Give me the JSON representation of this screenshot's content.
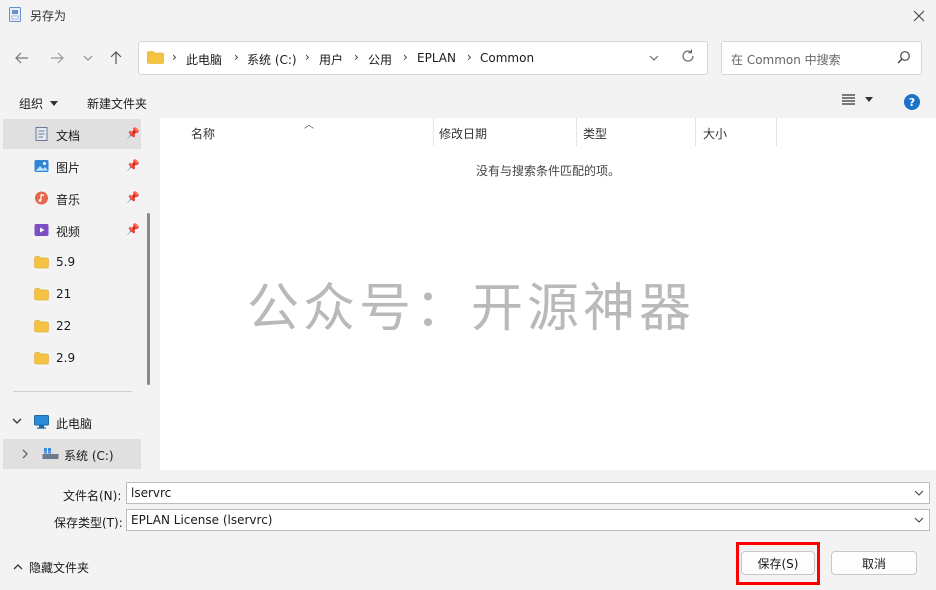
{
  "window": {
    "title": "另存为"
  },
  "address": {
    "crumbs": [
      "此电脑",
      "系统 (C:)",
      "用户",
      "公用",
      "EPLAN",
      "Common"
    ]
  },
  "search": {
    "placeholder": "在 Common 中搜索"
  },
  "toolbar": {
    "organize": "组织",
    "new_folder": "新建文件夹"
  },
  "sidebar": {
    "items": [
      {
        "label": "文档",
        "icon": "document-icon",
        "pinned": true
      },
      {
        "label": "图片",
        "icon": "picture-icon",
        "pinned": true
      },
      {
        "label": "音乐",
        "icon": "music-icon",
        "pinned": true
      },
      {
        "label": "视频",
        "icon": "video-icon",
        "pinned": true
      },
      {
        "label": "5.9",
        "icon": "folder-icon",
        "pinned": false
      },
      {
        "label": "21",
        "icon": "folder-icon",
        "pinned": false
      },
      {
        "label": "22",
        "icon": "folder-icon",
        "pinned": false
      },
      {
        "label": "2.9",
        "icon": "folder-icon",
        "pinned": false
      }
    ],
    "this_pc": "此电脑",
    "drive_c": "系统 (C:)"
  },
  "columns": [
    "名称",
    "修改日期",
    "类型",
    "大小"
  ],
  "empty_message": "没有与搜索条件匹配的项。",
  "watermark": "公众号：开源神器",
  "form": {
    "filename_label": "文件名(N):",
    "filename_value": "lservrc",
    "filetype_label": "保存类型(T):",
    "filetype_value": "EPLAN License (lservrc)"
  },
  "footer": {
    "hide_folders": "隐藏文件夹",
    "save": "保存(S)",
    "cancel": "取消"
  },
  "colors": {
    "accent": "#1a73c9",
    "highlight": "#ff0000",
    "folder": "#f5c242"
  }
}
